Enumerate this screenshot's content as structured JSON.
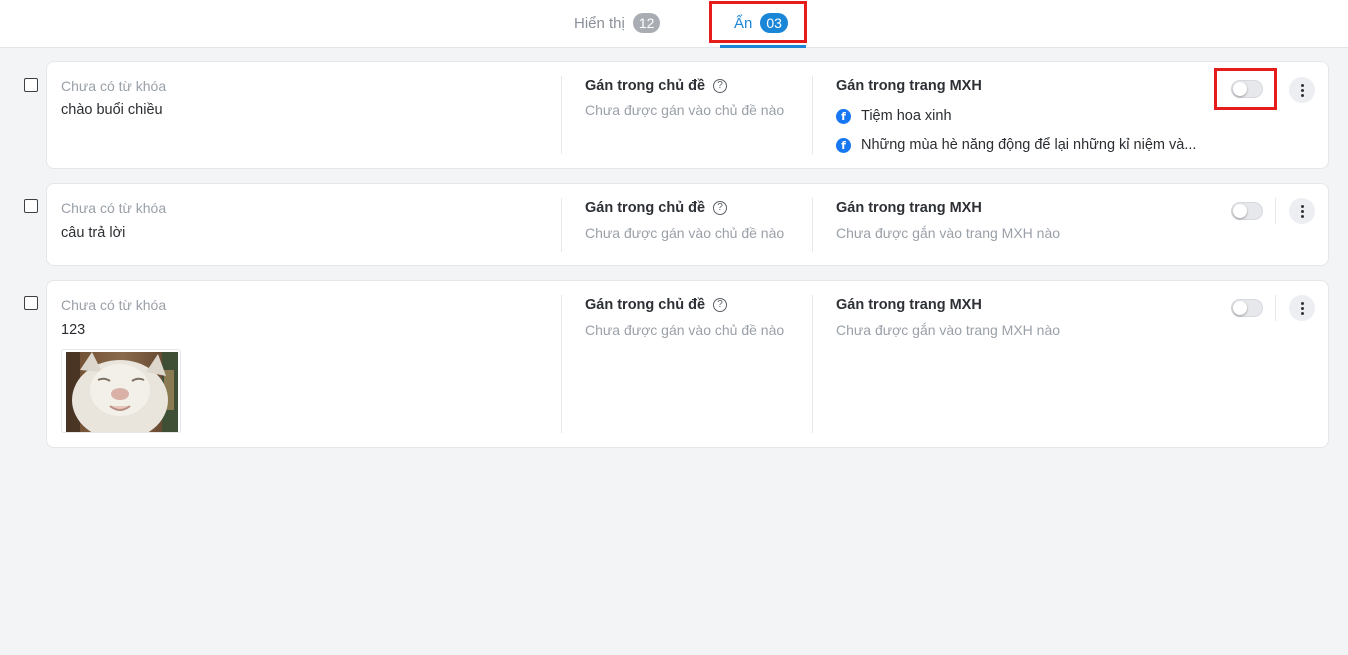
{
  "tabs": {
    "shown": {
      "label": "Hiển thị",
      "count": "12"
    },
    "hidden": {
      "label": "Ẩn",
      "count": "03"
    }
  },
  "labels": {
    "topic_header": "Gán trong chủ đề",
    "page_header": "Gán trong trang MXH"
  },
  "items": [
    {
      "keyword": "Chưa có từ khóa",
      "text": "chào buổi chiều",
      "topic_status": "Chưa được gán vào chủ đề nào",
      "pages": [
        "Tiệm hoa xinh",
        "Những mùa hè năng động để lại những kỉ niệm và..."
      ],
      "enabled": false
    },
    {
      "keyword": "Chưa có từ khóa",
      "text": "câu trả lời",
      "topic_status": "Chưa được gán vào chủ đề nào",
      "page_status": "Chưa được gắn vào trang MXH nào",
      "enabled": false
    },
    {
      "keyword": "Chưa có từ khóa",
      "text": "123",
      "topic_status": "Chưa được gán vào chủ đề nào",
      "page_status": "Chưa được gắn vào trang MXH nào",
      "has_image": true,
      "enabled": false
    }
  ],
  "colors": {
    "accent": "#1a86d8",
    "highlight": "#e51c1c",
    "facebook": "#1877f2"
  },
  "icons": {
    "help": "question-circle-icon",
    "page": "facebook-icon",
    "more": "more-vertical-icon"
  }
}
